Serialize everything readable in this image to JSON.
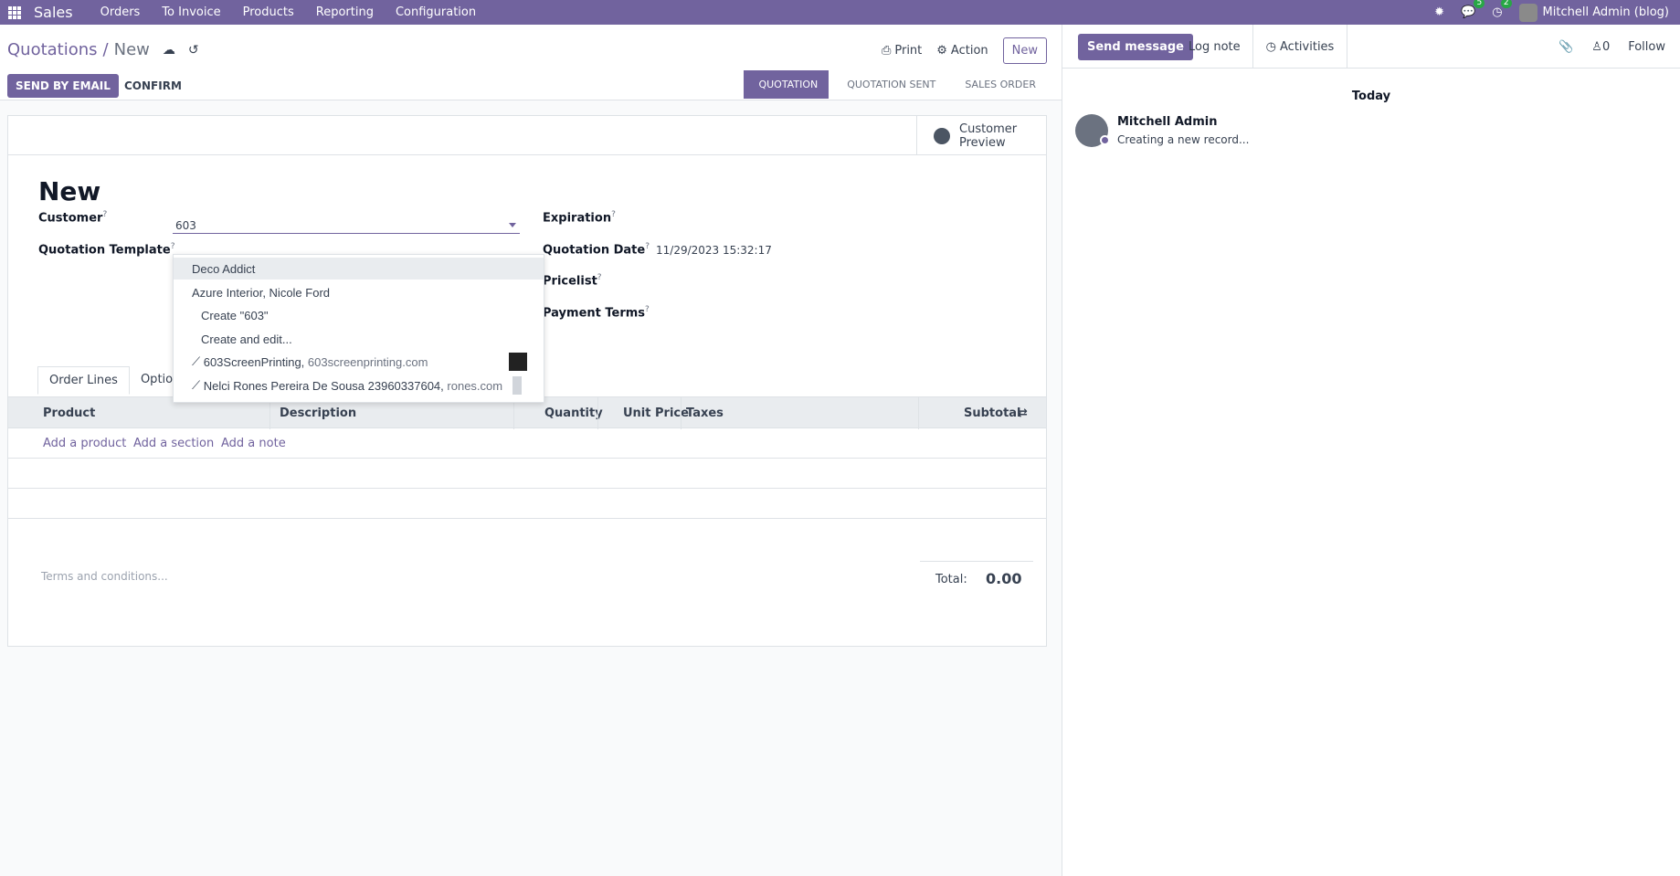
{
  "navbar": {
    "brand": "Sales",
    "menu": [
      "Orders",
      "To Invoice",
      "Products",
      "Reporting",
      "Configuration"
    ],
    "messages_badge": "5",
    "activities_badge": "2",
    "user": "Mitchell Admin (blog)"
  },
  "control_panel": {
    "breadcrumb_parent": "Quotations",
    "breadcrumb_separator": "/",
    "breadcrumb_current": "New",
    "print_label": "Print",
    "action_label": "Action",
    "new_label": "New"
  },
  "status_row": {
    "send_email_label": "SEND BY EMAIL",
    "confirm_label": "CONFIRM",
    "stages": [
      "QUOTATION",
      "QUOTATION SENT",
      "SALES ORDER"
    ],
    "active_stage": "QUOTATION"
  },
  "form": {
    "smart_button": {
      "line1": "Customer",
      "line2": "Preview"
    },
    "title": "New",
    "customer_label": "Customer",
    "customer_value": "603",
    "template_label": "Quotation Template",
    "expiration_label": "Expiration",
    "quotation_date_label": "Quotation Date",
    "quotation_date_value": "11/29/2023 15:32:17",
    "pricelist_label": "Pricelist",
    "payment_terms_label": "Payment Terms",
    "help_mark": "?"
  },
  "tabs": [
    "Order Lines",
    "Option"
  ],
  "table": {
    "headers": [
      "Product",
      "Description",
      "Quantity",
      "Unit Price",
      "Taxes",
      "Subtotal"
    ],
    "add_links": [
      "Add a product",
      "Add a section",
      "Add a note"
    ]
  },
  "footer": {
    "terms_placeholder": "Terms and conditions...",
    "total_label": "Total:",
    "total_value": "0.00"
  },
  "dropdown": {
    "items": [
      {
        "name": "Deco Addict",
        "extra": ""
      },
      {
        "name": "Azure Interior, Nicole Ford",
        "extra": ""
      },
      {
        "name": "Create \"603\"",
        "extra": ""
      },
      {
        "name": "Create and edit...",
        "extra": ""
      },
      {
        "name": "603ScreenPrinting,",
        "extra": "603screenprinting.com"
      },
      {
        "name": "Nelci Rones Pereira De Sousa 23960337604,",
        "extra": "rones.com"
      }
    ]
  },
  "chatter": {
    "send_message": "Send message",
    "log_note": "Log note",
    "activities": "Activities",
    "followers_count": "0",
    "follow": "Follow",
    "today": "Today",
    "author": "Mitchell Admin",
    "message": "Creating a new record..."
  },
  "colors": {
    "brand": "#71639e",
    "badge": "#28a745"
  }
}
